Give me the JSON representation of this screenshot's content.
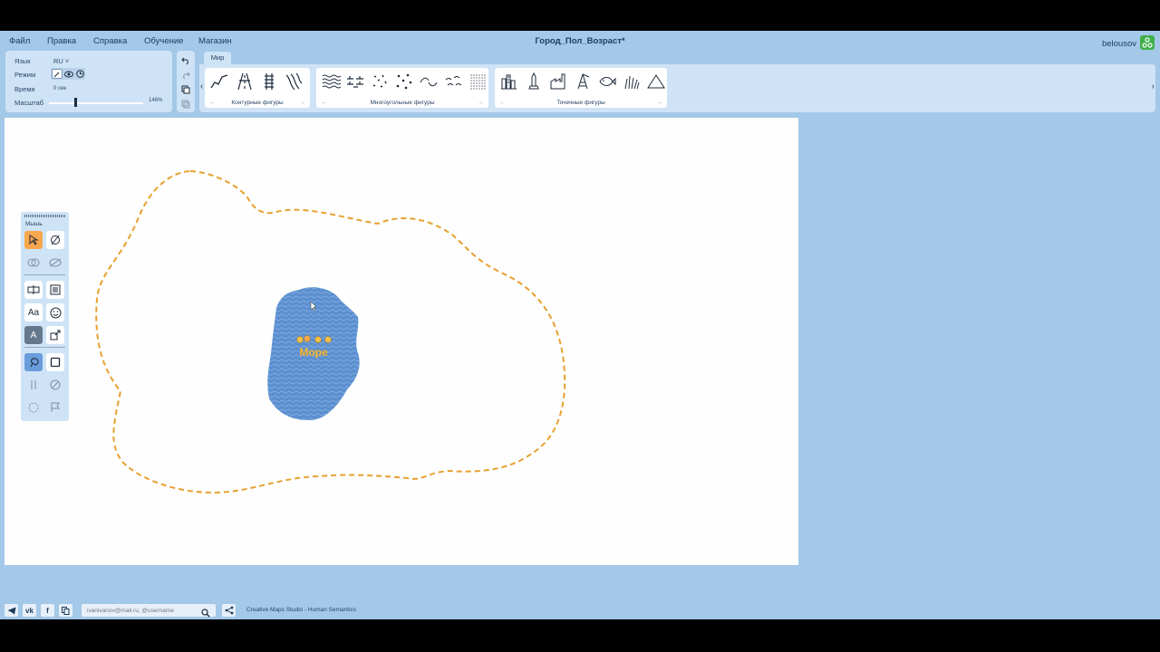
{
  "menu": {
    "items": [
      "Файл",
      "Правка",
      "Справка",
      "Обучение",
      "Магазин"
    ]
  },
  "document": {
    "title": "Город_Пол_Возраст*"
  },
  "user": {
    "name": "belousov"
  },
  "settings": {
    "language_label": "Язык",
    "language_value": "RU",
    "mode_label": "Режим",
    "time_label": "Время",
    "time_value": "0 сек",
    "scale_label": "Масштаб",
    "scale_value": "146%",
    "scale_level": 0.27
  },
  "ribbon": {
    "tab": "Мир",
    "groups": [
      {
        "label": "Контурные фигуры",
        "icons": [
          "road-line-icon",
          "highway-icon",
          "railway-icon",
          "river-icon"
        ]
      },
      {
        "label": "Многоугольные фигуры",
        "icons": [
          "water-pattern-icon",
          "swamp-pattern-icon",
          "dots-pattern-icon",
          "scatter-pattern-icon",
          "wave-pattern-icon",
          "ripple-pattern-icon",
          "sand-pattern-icon"
        ]
      },
      {
        "label": "Точечные фигуры",
        "icons": [
          "city-icon",
          "monument-icon",
          "factory-icon",
          "oil-rig-icon",
          "fish-icon",
          "grass-icon",
          "mountain-icon"
        ]
      }
    ]
  },
  "palette": {
    "title": "Мышь",
    "text_tool": "Aa",
    "underline_tool": "A"
  },
  "map": {
    "region_label": "Море",
    "colors": {
      "water": "#5b8fd0",
      "outline": "#e8a030",
      "label": "#f3c24a"
    }
  },
  "footer": {
    "search_placeholder": "ivanivanov@mail.ru, @username",
    "credit": "Creative Maps Studio - Human Semantics",
    "social": [
      "telegram-icon",
      "vk-icon",
      "facebook-icon",
      "copy-icon"
    ]
  }
}
